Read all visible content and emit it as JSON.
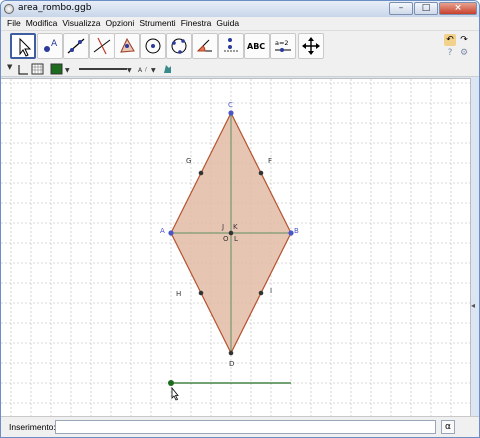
{
  "window": {
    "title": "area_rombo.ggb"
  },
  "menu": [
    "File",
    "Modifica",
    "Visualizza",
    "Opzioni",
    "Strumenti",
    "Finestra",
    "Guida"
  ],
  "toolbar": {
    "tools": [
      {
        "name": "move-tool-icon",
        "active": true
      },
      {
        "name": "point-tool-icon"
      },
      {
        "name": "line-tool-icon"
      },
      {
        "name": "perpendicular-line-tool-icon"
      },
      {
        "name": "polygon-tool-icon"
      },
      {
        "name": "circle-tool-icon"
      },
      {
        "name": "circle-through-points-tool-icon"
      },
      {
        "name": "angle-tool-icon"
      },
      {
        "name": "reflect-tool-icon"
      },
      {
        "name": "text-tool-icon",
        "label": "ABC"
      },
      {
        "name": "slider-tool-icon",
        "label": "a=2"
      },
      {
        "name": "move-graphics-view-tool-icon"
      }
    ]
  },
  "stylebar": {
    "point_style_label": "A",
    "color": "#1d6b1d"
  },
  "geometry": {
    "points": {
      "C": {
        "label": "C",
        "color": "#4b55c8"
      },
      "A": {
        "label": "A",
        "color": "#4b55c8"
      },
      "B": {
        "label": "B",
        "color": "#4b55c8"
      },
      "D": {
        "label": "D",
        "color": "#333333"
      },
      "G": {
        "label": "G",
        "color": "#333333"
      },
      "F": {
        "label": "F",
        "color": "#333333"
      },
      "H": {
        "label": "H",
        "color": "#333333"
      },
      "I": {
        "label": "I",
        "color": "#333333"
      },
      "J": {
        "label": "J",
        "color": "#333333"
      },
      "K": {
        "label": "K",
        "color": "#333333"
      },
      "O": {
        "label": "O",
        "color": "#333333"
      },
      "L": {
        "label": "L",
        "color": "#333333"
      }
    },
    "rhombus_fill": "#e2bba6",
    "rhombus_stroke": "#b5532f",
    "diagonal_color": "#5f8f5f",
    "slider_color": "#1d6b1d"
  },
  "input_bar": {
    "label": "Inserimento:",
    "value": "",
    "help_icon": "alpha-icon"
  },
  "colors": {
    "titlebar": "#c8d6ea",
    "grid": "#b8b8b8"
  }
}
